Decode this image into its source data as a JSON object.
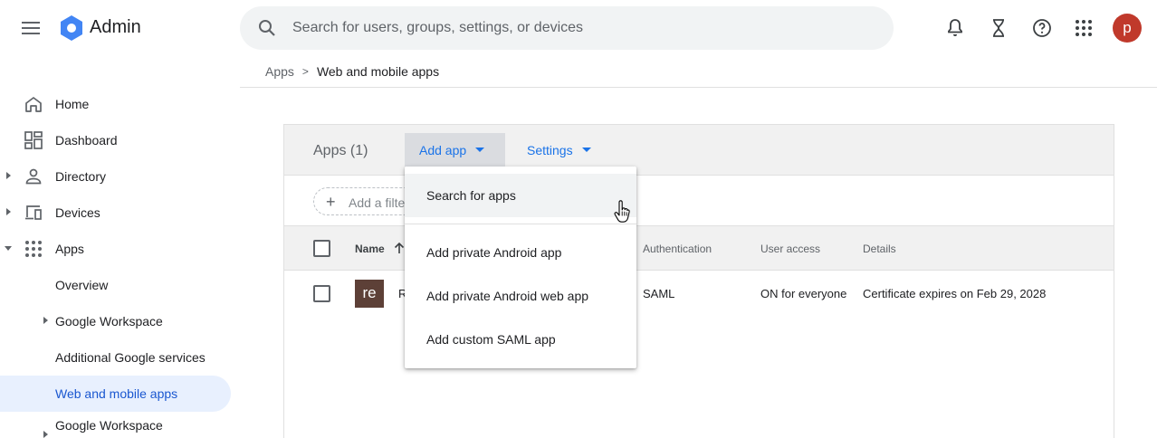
{
  "header": {
    "brand": "Admin",
    "search_placeholder": "Search for users, groups, settings, or devices",
    "avatar_letter": "p"
  },
  "breadcrumb": {
    "parent": "Apps",
    "separator": ">",
    "current": "Web and mobile apps"
  },
  "sidebar": {
    "items": [
      {
        "label": "Home"
      },
      {
        "label": "Dashboard"
      },
      {
        "label": "Directory"
      },
      {
        "label": "Devices"
      },
      {
        "label": "Apps"
      },
      {
        "label": "Overview"
      },
      {
        "label": "Google Workspace"
      },
      {
        "label": "Additional Google services"
      },
      {
        "label": "Web and mobile apps"
      },
      {
        "label": "Google Workspace"
      }
    ]
  },
  "panel": {
    "title": "Apps (1)",
    "add_app_label": "Add app",
    "settings_label": "Settings",
    "filter_label": "Add a filter",
    "columns": {
      "name": "Name",
      "authentication": "Authentication",
      "user_access": "User access",
      "details": "Details"
    },
    "rows": [
      {
        "badge": "re",
        "name": "R",
        "authentication": "SAML",
        "user_access": "ON for everyone",
        "details": "Certificate expires on Feb 29, 2028"
      }
    ]
  },
  "dropdown": {
    "items": [
      {
        "label": "Search for apps"
      },
      {
        "label": "Add private Android app"
      },
      {
        "label": "Add private Android web app"
      },
      {
        "label": "Add custom SAML app"
      }
    ]
  },
  "colors": {
    "accent": "#1a73e8",
    "active_nav_bg": "#e8f0fe",
    "avatar_bg": "#c0392b",
    "app_badge_bg": "#5d4037"
  }
}
